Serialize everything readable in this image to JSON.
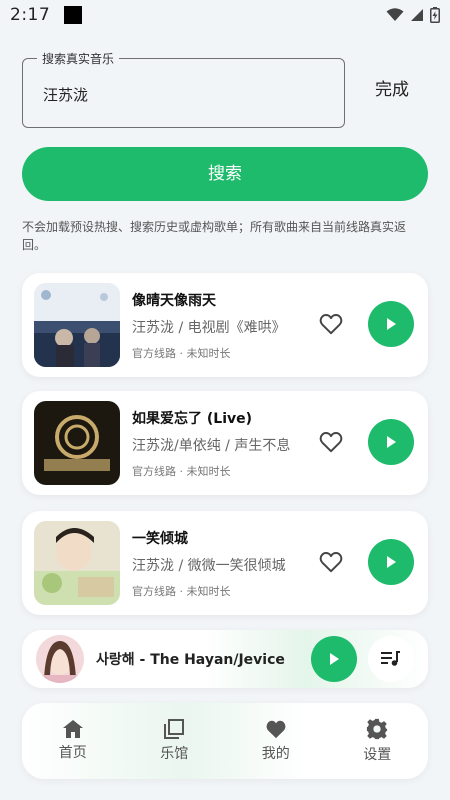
{
  "status_bar": {
    "time": "2:17",
    "icons": [
      "notification-square-icon",
      "wifi-icon",
      "signal-icon",
      "battery-charging-icon"
    ]
  },
  "search": {
    "legend": "搜索真实音乐",
    "value": "汪苏泷",
    "done_label": "完成",
    "button_label": "搜索"
  },
  "notice": "不会加载预设热搜、搜索历史或虚构歌单；所有歌曲来自当前线路真实返回。",
  "results": [
    {
      "title": "像晴天像雨天",
      "artist": "汪苏泷 / 电视剧《难哄》",
      "meta": "官方线路 · 未知时长"
    },
    {
      "title": "如果爱忘了 (Live)",
      "artist": "汪苏泷/单依纯 / 声生不息",
      "meta": "官方线路 · 未知时长"
    },
    {
      "title": "一笑倾城",
      "artist": "汪苏泷 / 微微一笑很倾城",
      "meta": "官方线路 · 未知时长"
    }
  ],
  "now_playing": {
    "song": "사랑해 - The Hayan/Jevice"
  },
  "tabs": [
    {
      "label": "首页",
      "icon": "home-icon"
    },
    {
      "label": "乐馆",
      "icon": "library-icon"
    },
    {
      "label": "我的",
      "icon": "heart-icon"
    },
    {
      "label": "设置",
      "icon": "gear-icon"
    }
  ],
  "colors": {
    "accent": "#1dbb6b",
    "background": "#f2f5f8",
    "card": "#ffffff"
  }
}
